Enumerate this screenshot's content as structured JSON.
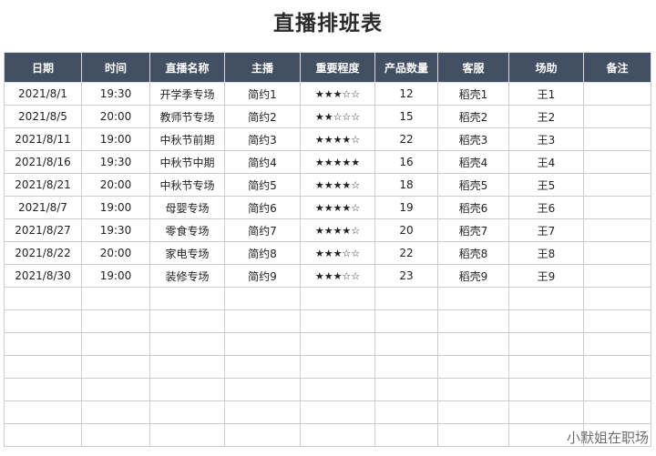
{
  "title": "直播排班表",
  "columns": [
    "日期",
    "时间",
    "直播名称",
    "主播",
    "重要程度",
    "产品数量",
    "客服",
    "场助",
    "备注"
  ],
  "rows": [
    {
      "date": "2021/8/1",
      "time": "19:30",
      "name": "开学季专场",
      "host": "简约1",
      "importance": "★★★☆☆",
      "importance_value": 3,
      "count": "12",
      "service": "稻壳1",
      "assistant": "王1",
      "note": ""
    },
    {
      "date": "2021/8/5",
      "time": "20:00",
      "name": "教师节专场",
      "host": "简约2",
      "importance": "★★☆☆☆",
      "importance_value": 2,
      "count": "15",
      "service": "稻壳2",
      "assistant": "王2",
      "note": ""
    },
    {
      "date": "2021/8/11",
      "time": "19:00",
      "name": "中秋节前期",
      "host": "简约3",
      "importance": "★★★★☆",
      "importance_value": 4,
      "count": "22",
      "service": "稻壳3",
      "assistant": "王3",
      "note": ""
    },
    {
      "date": "2021/8/16",
      "time": "19:30",
      "name": "中秋节中期",
      "host": "简约4",
      "importance": "★★★★★",
      "importance_value": 5,
      "count": "16",
      "service": "稻壳4",
      "assistant": "王4",
      "note": ""
    },
    {
      "date": "2021/8/21",
      "time": "20:00",
      "name": "中秋节专场",
      "host": "简约5",
      "importance": "★★★★☆",
      "importance_value": 4,
      "count": "18",
      "service": "稻壳5",
      "assistant": "王5",
      "note": ""
    },
    {
      "date": "2021/8/7",
      "time": "19:00",
      "name": "母婴专场",
      "host": "简约6",
      "importance": "★★★★☆",
      "importance_value": 4,
      "count": "19",
      "service": "稻壳6",
      "assistant": "王6",
      "note": ""
    },
    {
      "date": "2021/8/27",
      "time": "19:30",
      "name": "零食专场",
      "host": "简约7",
      "importance": "★★★★☆",
      "importance_value": 4,
      "count": "20",
      "service": "稻壳7",
      "assistant": "王7",
      "note": ""
    },
    {
      "date": "2021/8/22",
      "time": "20:00",
      "name": "家电专场",
      "host": "简约8",
      "importance": "★★★☆☆",
      "importance_value": 3,
      "count": "22",
      "service": "稻壳8",
      "assistant": "王8",
      "note": ""
    },
    {
      "date": "2021/8/30",
      "time": "19:00",
      "name": "装修专场",
      "host": "简约9",
      "importance": "★★★☆☆",
      "importance_value": 3,
      "count": "23",
      "service": "稻壳9",
      "assistant": "王9",
      "note": ""
    }
  ],
  "empty_rows": 7,
  "watermark": "小默姐在职场",
  "colors": {
    "header_bg": "#434f63",
    "header_text": "#ffffff",
    "grid": "#c9ccd1"
  }
}
